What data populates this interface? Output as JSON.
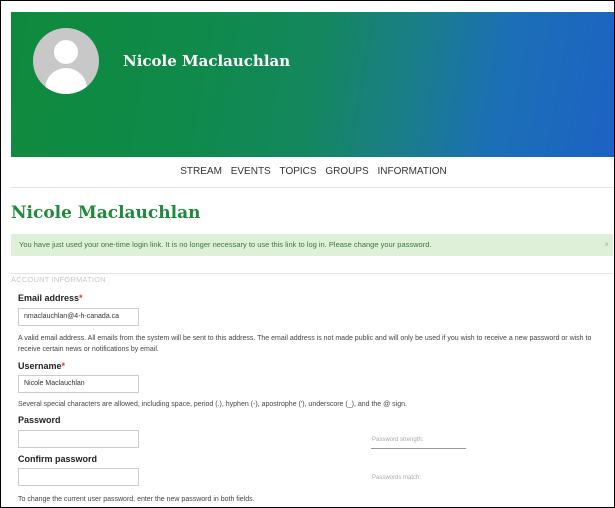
{
  "banner": {
    "name": "Nicole Maclauchlan",
    "avatar_icon": "user-avatar-icon"
  },
  "nav": {
    "items": [
      "STREAM",
      "EVENTS",
      "TOPICS",
      "GROUPS",
      "INFORMATION"
    ]
  },
  "page": {
    "title": "Nicole Maclauchlan"
  },
  "message": {
    "text": "You have just used your one-time login link. It is no longer necessary to use this link to log in. Please change your password.",
    "close": "×"
  },
  "account": {
    "legend": "ACCOUNT INFORMATION",
    "email": {
      "label": "Email address",
      "required": "*",
      "value": "nmaclauchlan@4-h-canada.ca",
      "description": "A valid email address. All emails from the system will be sent to this address. The email address is not made public and will only be used if you wish to receive a new password or wish to receive certain news or notifications by email."
    },
    "username": {
      "label": "Username",
      "required": "*",
      "value": "Nicole Maclauchlan",
      "description": "Several special characters are allowed, including space, period (.), hyphen (-), apostrophe ('), underscore (_), and the @ sign."
    },
    "password": {
      "label": "Password",
      "value": "",
      "strength_label": "Password strength:"
    },
    "confirm": {
      "label": "Confirm password",
      "value": "",
      "match_label": "Passwords match:"
    },
    "change_note": "To change the current user password, enter the new password in both fields."
  },
  "colors": {
    "banner_start": "#0f8a3c",
    "banner_end": "#1d62c4",
    "title": "#1e8a3a",
    "message_bg": "#dff0d8"
  }
}
